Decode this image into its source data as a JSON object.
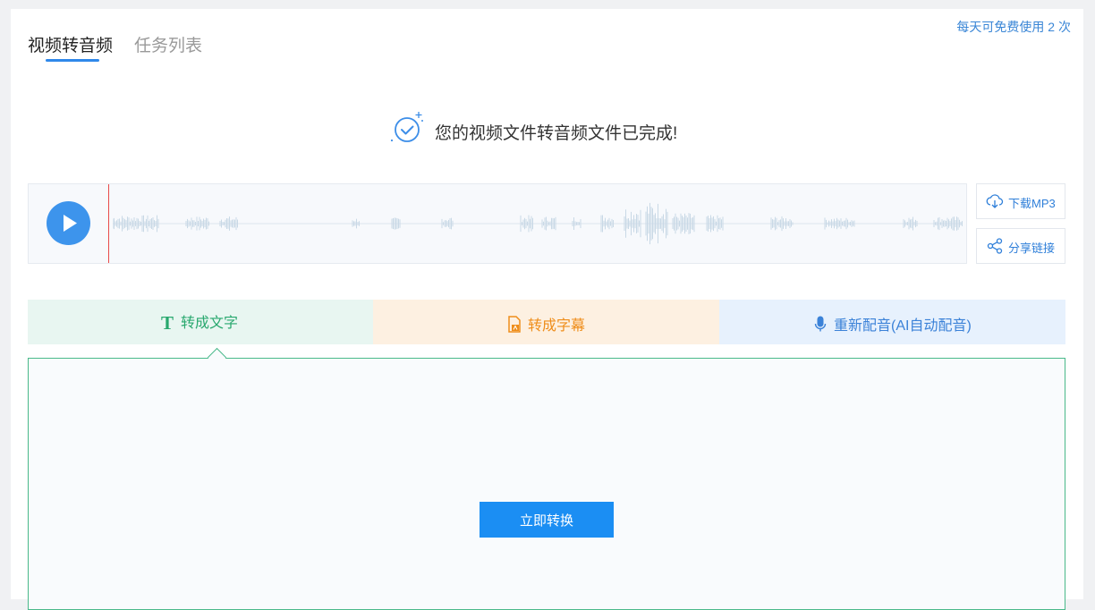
{
  "tabs": [
    {
      "label": "视频转音频",
      "active": true
    },
    {
      "label": "任务列表",
      "active": false
    }
  ],
  "quota_text": "每天可免费使用 2 次",
  "success_message": "您的视频文件转音频文件已完成!",
  "player": {
    "play_icon": "play-icon",
    "download_label": "下载MP3",
    "share_label": "分享链接"
  },
  "function_tabs": {
    "to_text": {
      "icon": "T",
      "label": "转成文字"
    },
    "to_subtitle": {
      "label": "转成字幕"
    },
    "redub": {
      "label": "重新配音(AI自动配音)"
    }
  },
  "convert_button_label": "立即转换",
  "colors": {
    "accent_blue": "#2f88ea",
    "green": "#28a86e",
    "orange": "#ef8d1a",
    "button_blue": "#1b8ef3",
    "playhead_red": "#e84a4a"
  }
}
